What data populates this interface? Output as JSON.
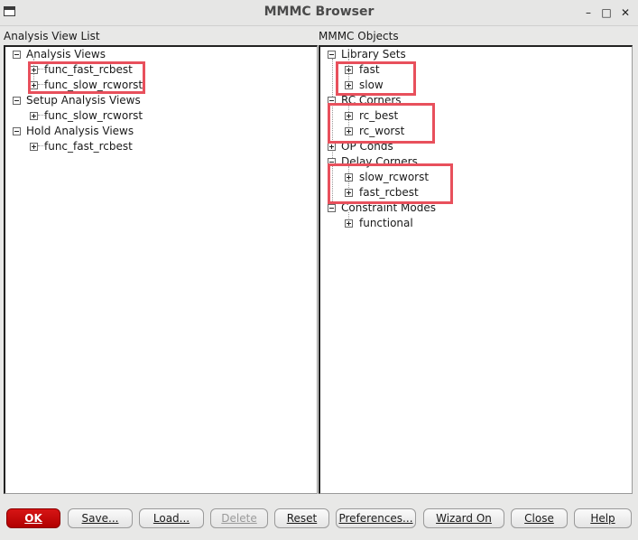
{
  "window": {
    "title": "MMMC Browser"
  },
  "left_panel": {
    "label": "Analysis View List",
    "groups": [
      {
        "label": "Analysis Views",
        "items": [
          "func_fast_rcbest",
          "func_slow_rcworst"
        ]
      },
      {
        "label": "Setup Analysis Views",
        "items": [
          "func_slow_rcworst"
        ]
      },
      {
        "label": "Hold Analysis Views",
        "items": [
          "func_fast_rcbest"
        ]
      }
    ]
  },
  "right_panel": {
    "label": "MMMC Objects",
    "groups": [
      {
        "label": "Library Sets",
        "items": [
          "fast",
          "slow"
        ]
      },
      {
        "label": "RC Corners",
        "items": [
          "rc_best",
          "rc_worst"
        ]
      },
      {
        "label": "OP Conds",
        "items": []
      },
      {
        "label": "Delay Corners",
        "items": [
          "slow_rcworst",
          "fast_rcbest"
        ]
      },
      {
        "label": "Constraint Modes",
        "items": [
          "functional"
        ]
      }
    ]
  },
  "buttons": {
    "ok": "OK",
    "save": "Save...",
    "load": "Load...",
    "delete": "Delete",
    "reset": "Reset",
    "preferences": "Preferences...",
    "wizard": "Wizard On",
    "close": "Close",
    "help": "Help"
  },
  "icons": {
    "window_menu": "window-menu-icon",
    "minimize": "minimize-icon",
    "maximize": "maximize-icon",
    "close": "close-icon",
    "expander": "expand-collapse-icon"
  },
  "colors": {
    "ok_button": "#c40a0a",
    "highlight_box": "#e8505c",
    "panel_background": "#ffffff",
    "window_background": "#e8e8e7"
  }
}
